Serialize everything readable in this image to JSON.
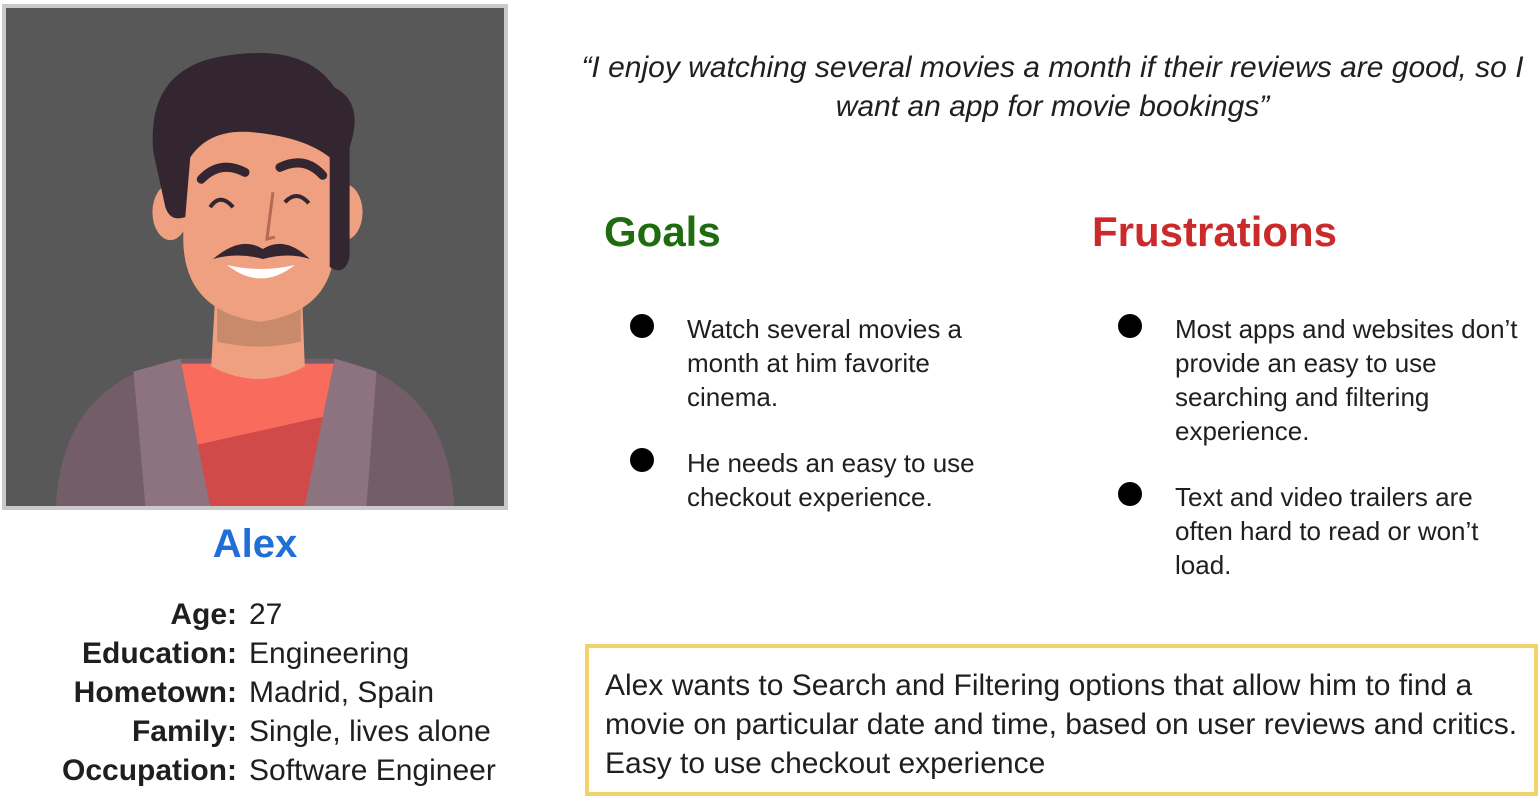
{
  "persona": {
    "name": "Alex",
    "details": [
      {
        "label": "Age:",
        "value": "27"
      },
      {
        "label": "Education:",
        "value": "Engineering"
      },
      {
        "label": "Hometown:",
        "value": "Madrid, Spain"
      },
      {
        "label": "Family:",
        "value": "Single, lives alone"
      },
      {
        "label": "Occupation:",
        "value": "Software Engineer"
      }
    ]
  },
  "quote": "“I enjoy watching several movies a month if their reviews are good, so I want an app for movie bookings”",
  "goals": {
    "title": "Goals",
    "items": [
      "Watch several movies a month at him favorite cinema.",
      "He needs an easy to use checkout experience."
    ]
  },
  "frustrations": {
    "title": "Frustrations",
    "items": [
      "Most apps and websites don’t provide an easy to use searching and filtering experience.",
      "Text and video trailers are often hard to read or won’t load."
    ]
  },
  "summary": "Alex wants to Search and Filtering options that allow him to find a movie on particular date and time, based on user reviews and critics. Easy to use checkout experience",
  "colors": {
    "name": "#1f6fd6",
    "goals_title": "#1e6c0f",
    "frustrations_title": "#cc2a2a",
    "summary_border": "#f3d26b",
    "portrait_background": "#585858"
  },
  "icons": {
    "portrait": "avatar-illustration",
    "bullet": "filled-circle"
  }
}
